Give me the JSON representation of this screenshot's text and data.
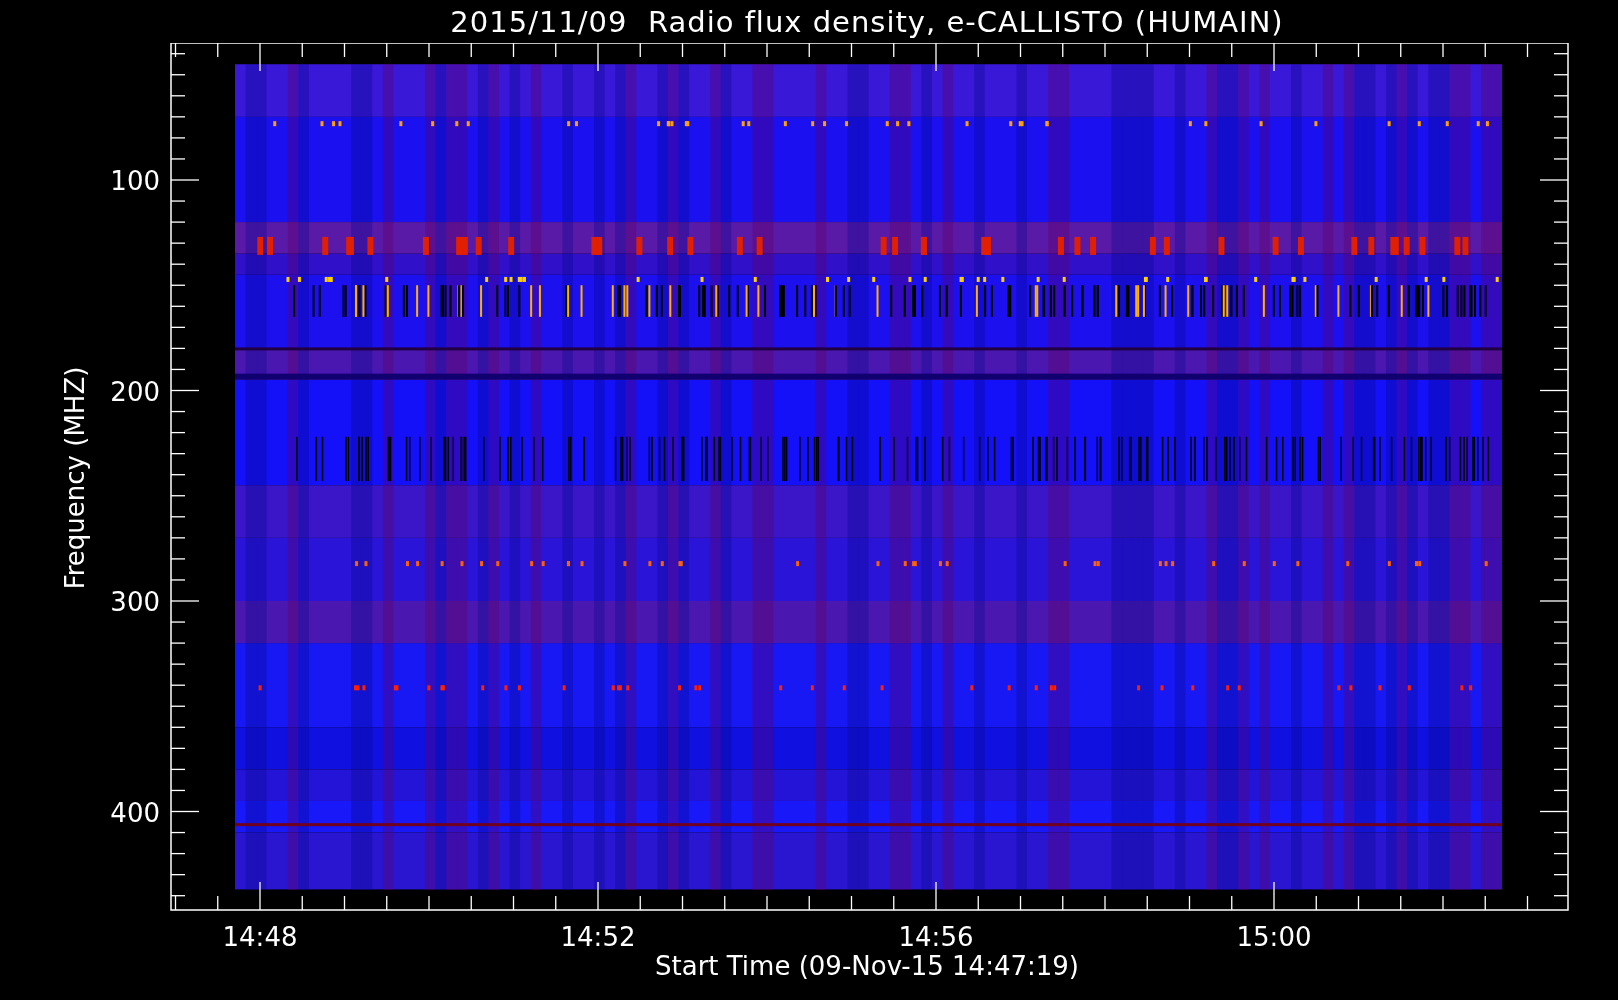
{
  "title": "2015/11/09  Radio flux density, e-CALLISTO (HUMAIN)",
  "y_axis": {
    "label": "Frequency (MHZ)",
    "ticks": [
      "100",
      "200",
      "300",
      "400"
    ]
  },
  "x_axis": {
    "label": "Start Time (09-Nov-15 14:47:19)",
    "ticks": [
      "14:48",
      "14:52",
      "14:56",
      "15:00"
    ]
  }
}
